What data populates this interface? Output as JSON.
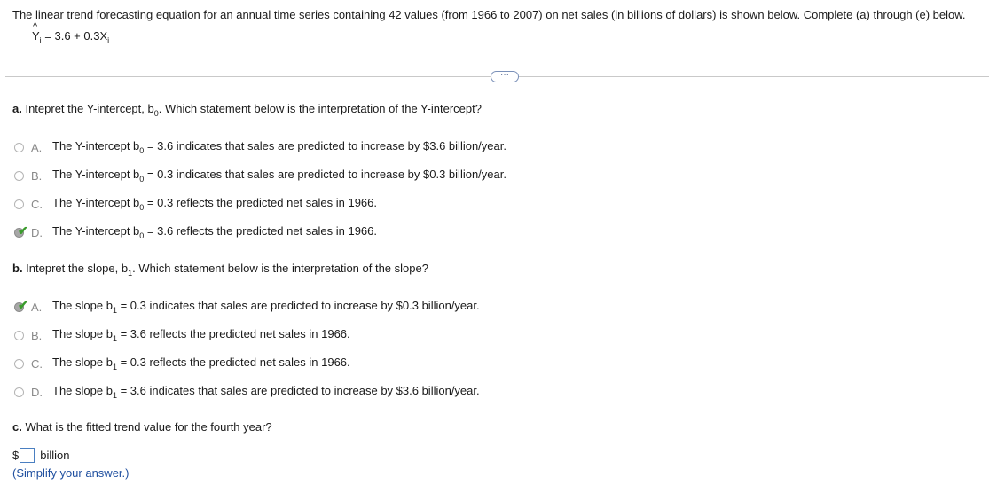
{
  "intro": "The linear trend forecasting equation for an annual time series containing 42 values (from 1966 to 2007) on net sales (in billions of dollars) is shown below. Complete (a) through (e) below.",
  "equation": {
    "lhs": "Y",
    "lhs_sub": "i",
    "rhs": " = 3.6 + 0.3X",
    "rhs_sub": "i"
  },
  "more_button_label": "···",
  "part_a": {
    "prefix": "a.",
    "text_before": " Intepret the Y-intercept, b",
    "sub": "0",
    "text_after": ". Which statement below is the interpretation of the Y-intercept?",
    "options": [
      {
        "letter": "A.",
        "pre": "The Y-intercept b",
        "sub": "0",
        "post": " = 3.6 indicates that sales are predicted to increase by $3.6 billion/year.",
        "selected": false
      },
      {
        "letter": "B.",
        "pre": "The Y-intercept b",
        "sub": "0",
        "post": " = 0.3 indicates that sales are predicted to increase by $0.3 billion/year.",
        "selected": false
      },
      {
        "letter": "C.",
        "pre": "The Y-intercept b",
        "sub": "0",
        "post": " = 0.3 reflects the predicted net sales in 1966.",
        "selected": false
      },
      {
        "letter": "D.",
        "pre": "The Y-intercept b",
        "sub": "0",
        "post": " = 3.6 reflects the predicted net sales in 1966.",
        "selected": true
      }
    ]
  },
  "part_b": {
    "prefix": "b.",
    "text_before": " Intepret the slope, b",
    "sub": "1",
    "text_after": ". Which statement  below is the interpretation of the slope?",
    "options": [
      {
        "letter": "A.",
        "pre": "The slope b",
        "sub": "1",
        "post": " = 0.3 indicates that sales are predicted to increase by $0.3 billion/year.",
        "selected": true
      },
      {
        "letter": "B.",
        "pre": "The slope b",
        "sub": "1",
        "post": " = 3.6 reflects the predicted net sales in 1966.",
        "selected": false
      },
      {
        "letter": "C.",
        "pre": "The slope b",
        "sub": "1",
        "post": " = 0.3 reflects the predicted net sales in 1966.",
        "selected": false
      },
      {
        "letter": "D.",
        "pre": "The slope b",
        "sub": "1",
        "post": " = 3.6 indicates that sales are predicted to increase by $3.6 billion/year.",
        "selected": false
      }
    ]
  },
  "part_c": {
    "prefix": "c.",
    "text": " What is the fitted trend value for the fourth year?",
    "currency": "$",
    "answer_value": "",
    "unit": "billion",
    "hint": "(Simplify your answer.)"
  },
  "colors": {
    "check": "#3a9b2c",
    "hint": "#1f4f9f",
    "answer_border": "#4a7fc1"
  }
}
